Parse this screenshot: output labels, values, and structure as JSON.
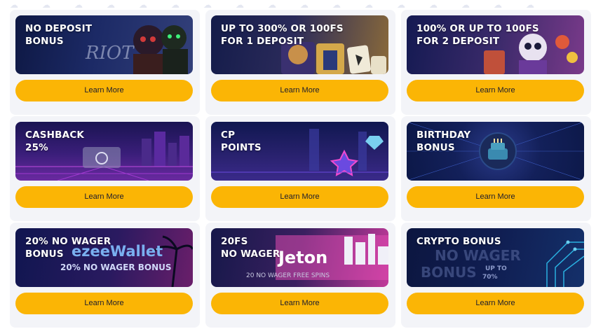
{
  "promotions": [
    {
      "title": "NO DEPOSIT\nBONUS",
      "button": "Learn More",
      "art_text": "RIOT",
      "colors": {
        "bg1": "#0e1844",
        "bg2": "#33407a"
      }
    },
    {
      "title": "UP TO 300% OR 100FS\nFOR 1 DEPOSIT",
      "button": "Learn More",
      "colors": {
        "bg1": "#141c4a",
        "bg2": "#8a6a3a"
      }
    },
    {
      "title": "100% OR UP TO 100FS\nFOR 2 DEPOSIT",
      "button": "Learn More",
      "colors": {
        "bg1": "#141a52",
        "bg2": "#7a3a8a"
      }
    },
    {
      "title": "CASHBACK\n25%",
      "button": "Learn More",
      "colors": {
        "bg1": "#1a1452",
        "bg2": "#6a2aa0"
      }
    },
    {
      "title": "CP\nPOINTS",
      "button": "Learn More",
      "colors": {
        "bg1": "#101850",
        "bg2": "#3a2a8a"
      }
    },
    {
      "title": "BIRTHDAY\nBONUS",
      "button": "Learn More",
      "colors": {
        "bg1": "#0c1848",
        "bg2": "#23307a"
      }
    },
    {
      "title": "20% NO WAGER\nBONUS",
      "button": "Learn More",
      "art_text": "ezeeWallet",
      "art_sub": "20% NO WAGER BONUS",
      "colors": {
        "bg1": "#101650",
        "bg2": "#6a1e6a"
      }
    },
    {
      "title": "20FS\nNO WAGER",
      "button": "Learn More",
      "art_text": "Jeton",
      "art_sub": "20 NO WAGER FREE SPINS",
      "colors": {
        "bg1": "#16184a",
        "bg2": "#c23a9a"
      }
    },
    {
      "title": "CRYPTO BONUS",
      "button": "Learn More",
      "art_text": "NO WAGER",
      "art_text2": "BONUS",
      "art_sub": "UP TO\n70%",
      "colors": {
        "bg1": "#0c1640",
        "bg2": "#14306a"
      }
    }
  ],
  "accent": "#fbb505"
}
